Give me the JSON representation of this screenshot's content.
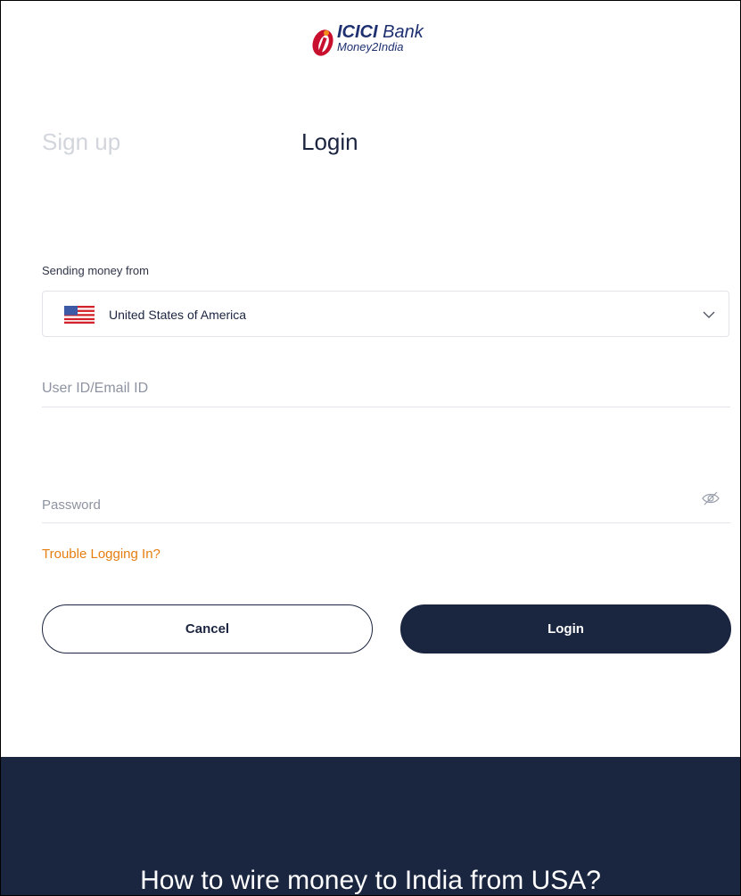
{
  "brand": {
    "name_bold": "ICICI",
    "name_rest": "Bank",
    "product": "Money2India"
  },
  "tabs": {
    "signup": "Sign up",
    "login": "Login",
    "active": "login"
  },
  "sending_from": {
    "label": "Sending money from",
    "selected_country": "United States of America",
    "flag_icon": "us-flag-icon"
  },
  "user_field": {
    "placeholder": "User ID/Email ID",
    "value": ""
  },
  "password_field": {
    "placeholder": "Password",
    "value": ""
  },
  "trouble_link": "Trouble Logging In?",
  "buttons": {
    "cancel": "Cancel",
    "login": "Login"
  },
  "footer": {
    "heading": "How to wire money to India from USA?"
  },
  "colors": {
    "primary": "#1a2540",
    "accent": "#e67e10",
    "logo_red": "#c8102e",
    "logo_orange": "#f28c1b",
    "logo_text": "#1e3070"
  }
}
